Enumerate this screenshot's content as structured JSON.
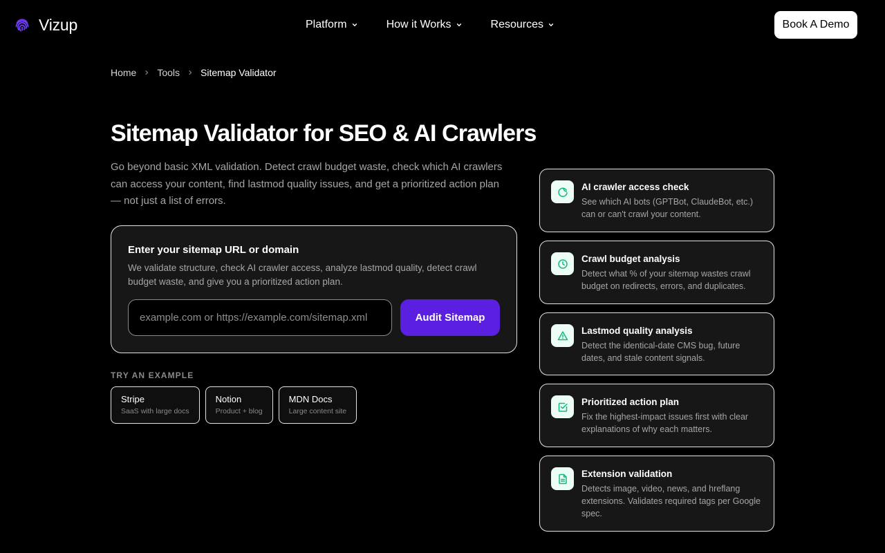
{
  "brand": {
    "name": "Vizup",
    "accent": "#5a1fe0",
    "icon_color": "#10b981"
  },
  "nav": {
    "items": [
      {
        "label": "Platform"
      },
      {
        "label": "How it Works"
      },
      {
        "label": "Resources"
      }
    ],
    "cta_label": "Book A Demo"
  },
  "breadcrumb": {
    "home": "Home",
    "tools": "Tools",
    "current": "Sitemap Validator"
  },
  "hero": {
    "title": "Sitemap Validator for SEO & AI Crawlers",
    "description": "Go beyond basic XML validation. Detect crawl budget waste, check which AI crawlers can access your content, find lastmod quality issues, and get a prioritized action plan — not just a list of errors."
  },
  "form": {
    "title": "Enter your sitemap URL or domain",
    "description": "We validate structure, check AI crawler access, analyze lastmod quality, detect crawl budget waste, and give you a prioritized action plan.",
    "input_value": "",
    "input_placeholder": "example.com or https://example.com/sitemap.xml",
    "submit_label": "Audit Sitemap"
  },
  "examples": {
    "label": "TRY AN EXAMPLE",
    "items": [
      {
        "name": "Stripe",
        "desc": "SaaS with large docs"
      },
      {
        "name": "Notion",
        "desc": "Product + blog"
      },
      {
        "name": "MDN Docs",
        "desc": "Large content site"
      }
    ]
  },
  "features": [
    {
      "icon": "bot-icon",
      "title": "AI crawler access check",
      "desc": "See which AI bots (GPTBot, ClaudeBot, etc.) can or can't crawl your content."
    },
    {
      "icon": "clock-icon",
      "title": "Crawl budget analysis",
      "desc": "Detect what % of your sitemap wastes crawl budget on redirects, errors, and duplicates."
    },
    {
      "icon": "warning-icon",
      "title": "Lastmod quality analysis",
      "desc": "Detect the identical-date CMS bug, future dates, and stale content signals."
    },
    {
      "icon": "checkbox-icon",
      "title": "Prioritized action plan",
      "desc": "Fix the highest-impact issues first with clear explanations of why each matters."
    },
    {
      "icon": "document-icon",
      "title": "Extension validation",
      "desc": "Detects image, video, news, and hreflang extensions. Validates required tags per Google spec."
    }
  ]
}
